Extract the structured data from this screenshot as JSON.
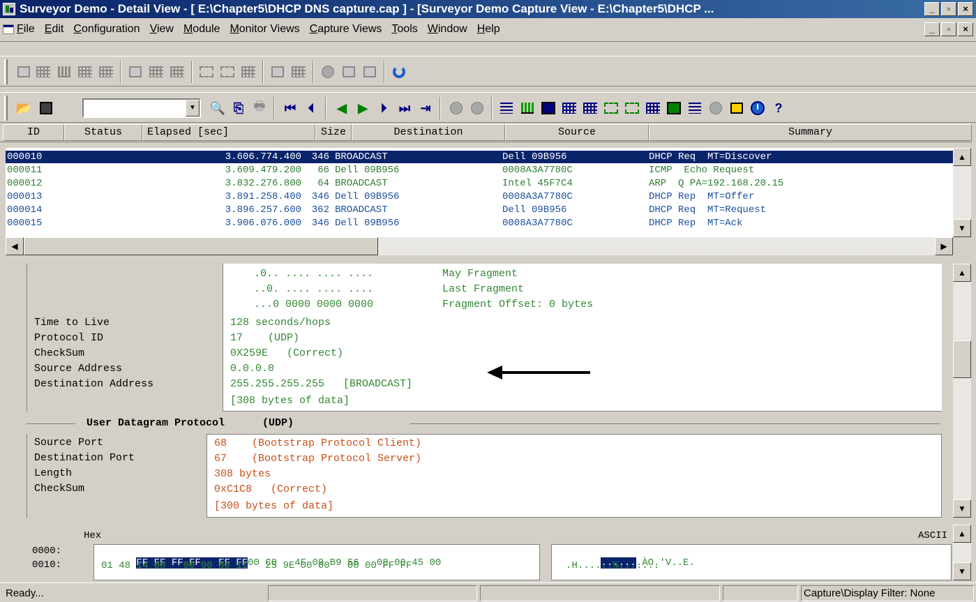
{
  "window": {
    "title": "Surveyor Demo - Detail View - [ E:\\Chapter5\\DHCP DNS capture.cap ] - [Surveyor Demo Capture View - E:\\Chapter5\\DHCP ...",
    "controls": [
      "_",
      "▫",
      "×"
    ]
  },
  "menu": {
    "items": [
      "File",
      "Edit",
      "Configuration",
      "View",
      "Module",
      "Monitor Views",
      "Capture Views",
      "Tools",
      "Window",
      "Help"
    ]
  },
  "toolbar2": {
    "combo_value": ""
  },
  "packet_list": {
    "columns": [
      "ID",
      "Status",
      "Elapsed [sec]",
      "Size",
      "Destination",
      "Source",
      "Summary"
    ],
    "rows": [
      {
        "id": "000010",
        "elapsed": "3.606.774.400",
        "size": "346",
        "destination": "BROADCAST",
        "source": "Dell 09B956",
        "summary": "DHCP Req  MT=Discover",
        "color": "#1a4f9c"
      },
      {
        "id": "000011",
        "elapsed": "3.609.479.200",
        "size": "66",
        "destination": "Dell 09B956",
        "source": "0008A3A7780C",
        "summary": "ICMP  Echo Request",
        "color": "#2e7d32"
      },
      {
        "id": "000012",
        "elapsed": "3.832.276.800",
        "size": "64",
        "destination": "BROADCAST",
        "source": "Intel 45F7C4",
        "summary": "ARP  Q PA=192.168.20.15",
        "color": "#2e7d32"
      },
      {
        "id": "000013",
        "elapsed": "3.891.258.400",
        "size": "346",
        "destination": "Dell 09B956",
        "source": "0008A3A7780C",
        "summary": "DHCP Rep  MT=Offer",
        "color": "#1a4f9c"
      },
      {
        "id": "000014",
        "elapsed": "3.896.257.600",
        "size": "362",
        "destination": "BROADCAST",
        "source": "Dell 09B956",
        "summary": "DHCP Req  MT=Request",
        "color": "#1a4f9c"
      },
      {
        "id": "000015",
        "elapsed": "3.906.076.000",
        "size": "346",
        "destination": "Dell 09B956",
        "source": "0008A3A7780C",
        "summary": "DHCP Rep  MT=Ack",
        "color": "#1a4f9c"
      }
    ]
  },
  "detail": {
    "ip_flags": [
      {
        "bits": ".0.. .... .... ....",
        "desc": "May Fragment"
      },
      {
        "bits": "..0. .... .... ....",
        "desc": "Last Fragment"
      },
      {
        "bits": "...0 0000 0000 0000",
        "desc": "Fragment Offset: 0 bytes"
      }
    ],
    "ip_fields": [
      {
        "label": "Time to Live",
        "value": "128 seconds/hops"
      },
      {
        "label": "Protocol ID",
        "value": "17    (UDP)"
      },
      {
        "label": "CheckSum",
        "value": "0X259E   (Correct)"
      },
      {
        "label": "Source Address",
        "value": "0.0.0.0"
      },
      {
        "label": "Destination Address",
        "value": "255.255.255.255   [BROADCAST]"
      }
    ],
    "ip_data_note": "[308 bytes of data]",
    "udp_section_title": "User Datagram Protocol      (UDP)",
    "udp_fields": [
      {
        "label": "Source Port",
        "value": "68    (Bootstrap Protocol Client)"
      },
      {
        "label": "Destination Port",
        "value": "67    (Bootstrap Protocol Server)"
      },
      {
        "label": "Length",
        "value": "308 bytes"
      },
      {
        "label": "CheckSum",
        "value": "0xC1C8   (Correct)"
      }
    ],
    "udp_data_note": "[300 bytes of data]"
  },
  "hex": {
    "hex_label": "Hex",
    "ascii_label": "ASCII",
    "rows": [
      {
        "offset": "0000:",
        "hex_highlight": "FF FF FF FF   FF FF",
        "hex_rest": "00 C0   4F 09 B9 56   08 00 45 00",
        "ascii_highlight": "......",
        "ascii_rest": ".ÀO.'V..E."
      },
      {
        "offset": "0010:",
        "hex_highlight": "",
        "hex_rest": "01 48 14 08   00 00 80 11   25 9E 00 00   00 00 FF FF",
        "ascii_highlight": "",
        "ascii_rest": ".H......%......."
      }
    ]
  },
  "statusbar": {
    "message": "Ready...",
    "filter": "Capture\\Display Filter: None"
  }
}
